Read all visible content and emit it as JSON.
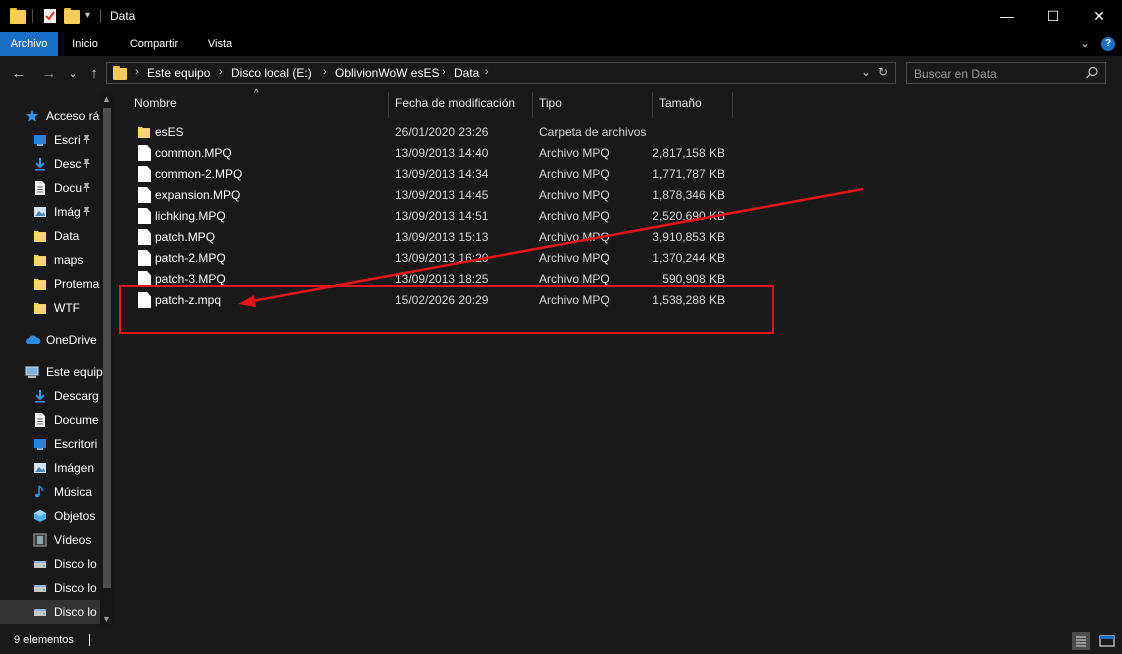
{
  "window": {
    "title": "Data",
    "minimize_glyph": "—",
    "maximize_glyph": "☐",
    "close_glyph": "✕"
  },
  "ribbon": {
    "tabs": [
      "Archivo",
      "Inicio",
      "Compartir",
      "Vista"
    ],
    "active_tab": "Archivo",
    "expand_glyph": "⌄",
    "help_glyph": "?",
    "accent_color": "#1a6fc4"
  },
  "nav": {
    "back_glyph": "←",
    "forward_glyph": "→",
    "recent_glyph": "⌄",
    "up_glyph": "↑"
  },
  "address": {
    "breadcrumbs": [
      "Este equipo",
      "Disco local (E:)",
      "OblivionWoW esES",
      "Data"
    ],
    "separator": "›",
    "dropdown_glyph": "⌄",
    "refresh_glyph": "↻"
  },
  "search": {
    "placeholder": "Buscar en Data"
  },
  "sidebar": {
    "items": [
      {
        "label": "Acceso rá",
        "icon": "star-icon",
        "pinned": false
      },
      {
        "label": "Escri",
        "icon": "desktop-icon",
        "pinned": true
      },
      {
        "label": "Desc",
        "icon": "download-icon",
        "pinned": true
      },
      {
        "label": "Docu",
        "icon": "document-icon",
        "pinned": true
      },
      {
        "label": "Imág",
        "icon": "pictures-icon",
        "pinned": true
      },
      {
        "label": "Data",
        "icon": "folder-icon",
        "pinned": false
      },
      {
        "label": "maps",
        "icon": "folder-icon",
        "pinned": false
      },
      {
        "label": "Protema",
        "icon": "folder-icon",
        "pinned": false
      },
      {
        "label": "WTF",
        "icon": "folder-icon",
        "pinned": false
      },
      {
        "label": "OneDrive",
        "icon": "cloud-icon",
        "pinned": false
      },
      {
        "label": "Este equip",
        "icon": "computer-icon",
        "pinned": false
      },
      {
        "label": "Descarg",
        "icon": "download-icon",
        "pinned": false
      },
      {
        "label": "Docume",
        "icon": "document-icon",
        "pinned": false
      },
      {
        "label": "Escritori",
        "icon": "desktop-icon",
        "pinned": false
      },
      {
        "label": "Imágen",
        "icon": "pictures-icon",
        "pinned": false
      },
      {
        "label": "Música",
        "icon": "music-icon",
        "pinned": false
      },
      {
        "label": "Objetos",
        "icon": "3d-objects-icon",
        "pinned": false
      },
      {
        "label": "Vídeos",
        "icon": "video-icon",
        "pinned": false
      },
      {
        "label": "Disco lo",
        "icon": "drive-icon",
        "pinned": false
      },
      {
        "label": "Disco lo",
        "icon": "drive-icon",
        "pinned": false
      },
      {
        "label": "Disco lo",
        "icon": "drive-icon",
        "pinned": false
      }
    ],
    "pin_glyph": "📌"
  },
  "columns": {
    "name": "Nombre",
    "modified": "Fecha de modificación",
    "type": "Tipo",
    "size": "Tamaño"
  },
  "files": [
    {
      "name": "esES",
      "modified": "26/01/2020 23:26",
      "type": "Carpeta de archivos",
      "size": "",
      "kind": "folder"
    },
    {
      "name": "common.MPQ",
      "modified": "13/09/2013 14:40",
      "type": "Archivo MPQ",
      "size": "2,817,158 KB",
      "kind": "file"
    },
    {
      "name": "common-2.MPQ",
      "modified": "13/09/2013 14:34",
      "type": "Archivo MPQ",
      "size": "1,771,787 KB",
      "kind": "file"
    },
    {
      "name": "expansion.MPQ",
      "modified": "13/09/2013 14:45",
      "type": "Archivo MPQ",
      "size": "1,878,346 KB",
      "kind": "file"
    },
    {
      "name": "lichking.MPQ",
      "modified": "13/09/2013 14:51",
      "type": "Archivo MPQ",
      "size": "2,520,690 KB",
      "kind": "file"
    },
    {
      "name": "patch.MPQ",
      "modified": "13/09/2013 15:13",
      "type": "Archivo MPQ",
      "size": "3,910,853 KB",
      "kind": "file"
    },
    {
      "name": "patch-2.MPQ",
      "modified": "13/09/2013 16:20",
      "type": "Archivo MPQ",
      "size": "1,370,244 KB",
      "kind": "file"
    },
    {
      "name": "patch-3.MPQ",
      "modified": "13/09/2013 18:25",
      "type": "Archivo MPQ",
      "size": "590,908 KB",
      "kind": "file"
    },
    {
      "name": "patch-z.mpq",
      "modified": "15/02/2026 20:29",
      "type": "Archivo MPQ",
      "size": "1,538,288 KB",
      "kind": "file"
    }
  ],
  "status": {
    "item_count": "9 elementos"
  },
  "annotation": {
    "color": "#e3141a"
  }
}
